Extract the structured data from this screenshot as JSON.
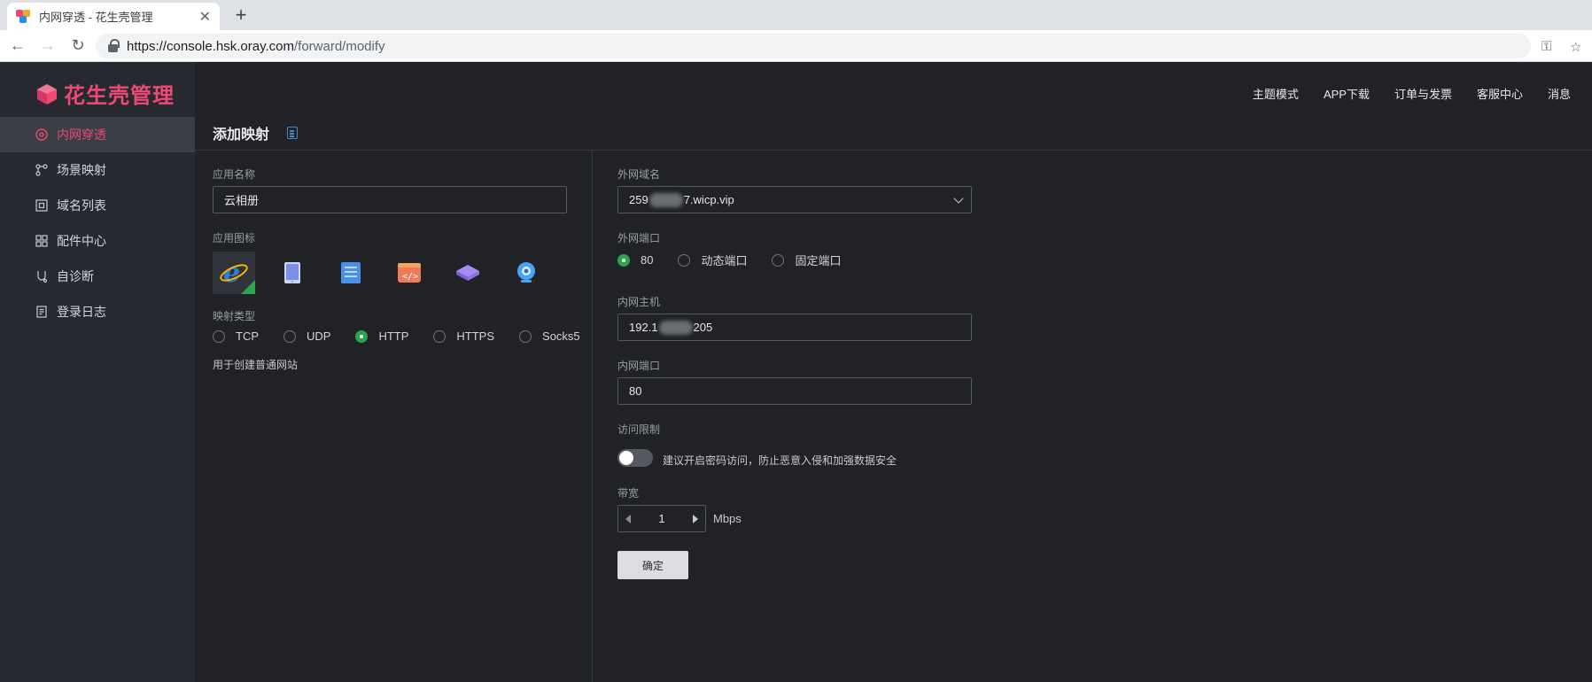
{
  "browser": {
    "tab_title": "内网穿透 - 花生壳管理",
    "url_host": "https://console.hsk.oray.com",
    "url_path": "/forward/modify"
  },
  "brand": {
    "logo_text": "花生壳管理",
    "accent": "#ef4874",
    "success": "#2ea44f"
  },
  "sidebar": {
    "items": [
      {
        "label": "内网穿透",
        "icon": "network-icon",
        "active": true
      },
      {
        "label": "场景映射",
        "icon": "scene-icon"
      },
      {
        "label": "域名列表",
        "icon": "domain-icon"
      },
      {
        "label": "配件中心",
        "icon": "grid-icon"
      },
      {
        "label": "自诊断",
        "icon": "diagnose-icon"
      },
      {
        "label": "登录日志",
        "icon": "log-icon"
      }
    ]
  },
  "topnav": [
    "主题模式",
    "APP下载",
    "订单与发票",
    "客服中心",
    "消息"
  ],
  "page": {
    "title": "添加映射"
  },
  "form_left": {
    "app_name_label": "应用名称",
    "app_name_value": "云相册",
    "app_icon_label": "应用图标",
    "app_icons": [
      "ie-icon",
      "tablet-icon",
      "server-icon",
      "code-icon",
      "layers-icon",
      "webcam-icon"
    ],
    "mapping_type_label": "映射类型",
    "mapping_types": [
      "TCP",
      "UDP",
      "HTTP",
      "HTTPS",
      "Socks5"
    ],
    "mapping_selected": "HTTP",
    "mapping_hint": "用于创建普通网站"
  },
  "form_right": {
    "ext_domain_label": "外网域名",
    "ext_domain_prefix": "259",
    "ext_domain_suffix": "7.wicp.vip",
    "ext_port_label": "外网端口",
    "ext_port_options": [
      "80",
      "动态端口",
      "固定端口"
    ],
    "ext_port_selected": "80",
    "int_host_label": "内网主机",
    "int_host_prefix": "192.1",
    "int_host_suffix": "205",
    "int_port_label": "内网端口",
    "int_port_value": "80",
    "access_label": "访问限制",
    "access_hint": "建议开启密码访问，防止恶意入侵和加强数据安全",
    "bandwidth_label": "带宽",
    "bandwidth_value": "1",
    "bandwidth_unit": "Mbps",
    "submit_label": "确定"
  }
}
